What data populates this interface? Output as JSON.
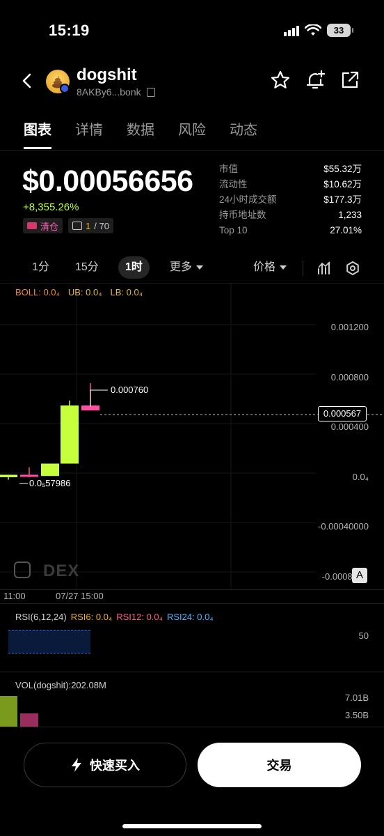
{
  "status": {
    "time": "15:19",
    "battery": "33"
  },
  "header": {
    "token_name": "dogshit",
    "token_address": "8AKBy6...bonk",
    "icons": [
      "back-chevron-icon",
      "favorite-star-icon",
      "add-alert-bell-icon",
      "share-external-icon"
    ]
  },
  "tabs": [
    "图表",
    "详情",
    "数据",
    "风险",
    "动态"
  ],
  "price": {
    "value": "$0.00056656",
    "change": "+8,355.26%",
    "tag_clear": "清仓",
    "tag_count": "1",
    "tag_total": "/ 70"
  },
  "stats": [
    {
      "label": "市值",
      "value": "$55.32万"
    },
    {
      "label": "流动性",
      "value": "$10.62万"
    },
    {
      "label": "24小时成交额",
      "value": "$177.3万"
    },
    {
      "label": "持币地址数",
      "value": "1,233"
    },
    {
      "label": "Top 10",
      "value": "27.01%"
    }
  ],
  "toolbar": {
    "intervals": [
      "1分",
      "15分",
      "1时",
      "更多"
    ],
    "active_interval": "1时",
    "price_mode": "价格"
  },
  "chart": {
    "boll": "BOLL: 0.0₄",
    "ub": "UB: 0.0₄",
    "lb": "LB: 0.0₄",
    "y_labels": [
      "0.001200",
      "0.000800",
      "0.000400",
      "0.0₄",
      "-0.00040000",
      "-0.00080"
    ],
    "current_price_tag": "0.000567",
    "high_annotation": "0.000760",
    "low_annotation": "0.0₅57986",
    "x_labels": [
      "11:00",
      "07/27 15:00"
    ],
    "watermark": "DEX",
    "auto_label": "A",
    "candles": [
      {
        "open": 0.0,
        "high": 2e-05,
        "low": -2e-05,
        "close": 2e-05,
        "color": "#c6ff3b"
      },
      {
        "open": 2e-05,
        "high": 8e-05,
        "low": 0.0,
        "close": 2e-05,
        "color": "#ff4fa0"
      },
      {
        "open": 1e-05,
        "high": 0.00011,
        "low": 1e-05,
        "close": 0.00011,
        "color": "#c6ff3b"
      },
      {
        "open": 0.00011,
        "high": 0.00062,
        "low": 0.00011,
        "close": 0.00058,
        "color": "#c6ff3b"
      },
      {
        "open": 0.00058,
        "high": 0.00076,
        "low": 0.00054,
        "close": 0.00054,
        "color": "#ff4fa0"
      }
    ],
    "colors": {
      "up": "#c6ff3b",
      "down": "#ff4fa0"
    }
  },
  "rsi": {
    "title": "RSI(6,12,24)",
    "rsi6": "RSI6: 0.0₄",
    "rsi12": "RSI12: 0.0₄",
    "rsi24": "RSI24: 0.0₄",
    "level": "50"
  },
  "volume": {
    "label": "VOL(dogshit):202.08M",
    "y_labels": [
      "7.01B",
      "3.50B"
    ]
  },
  "actions": {
    "quick_buy": "快速买入",
    "trade": "交易"
  }
}
